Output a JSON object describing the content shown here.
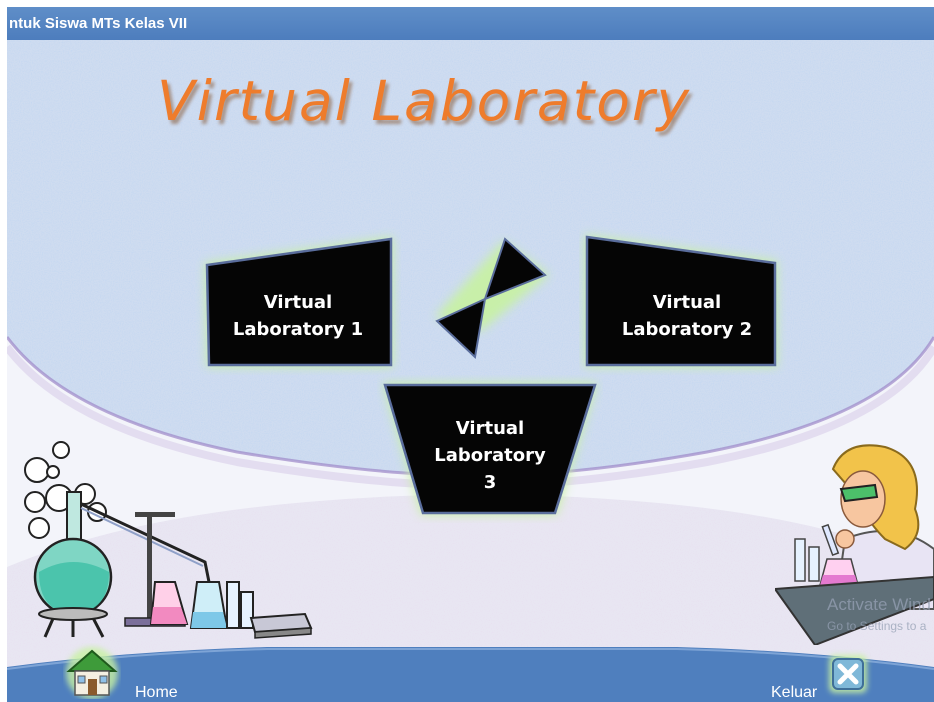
{
  "window": {
    "title": "ntuk Siswa MTs Kelas VII"
  },
  "main": {
    "title": "Virtual Laboratory",
    "buttons": [
      {
        "line1": "Virtual",
        "line2": "Laboratory 1"
      },
      {
        "line1": "Virtual",
        "line2": "Laboratory 2"
      },
      {
        "line1": "Virtual",
        "line2": "Laboratory",
        "line3": "3"
      }
    ]
  },
  "footer": {
    "home_label": "Home",
    "exit_label": "Keluar"
  },
  "watermark": {
    "line1": "Activate Wind",
    "line2": "Go to Settings to a"
  },
  "colors": {
    "titlebar": "#5a89c6",
    "title_text": "#ee7c2c",
    "button_fill": "#000000",
    "button_border": "#5a6d9c",
    "glow": "#c8f2a2",
    "footer": "#4f7fbe"
  },
  "icons": {
    "home": "house-icon",
    "exit": "close-x-icon",
    "hourglass": "hourglass-decoration",
    "lab_left": "chemistry-apparatus-clipart",
    "lab_right": "scientist-woman-clipart"
  }
}
